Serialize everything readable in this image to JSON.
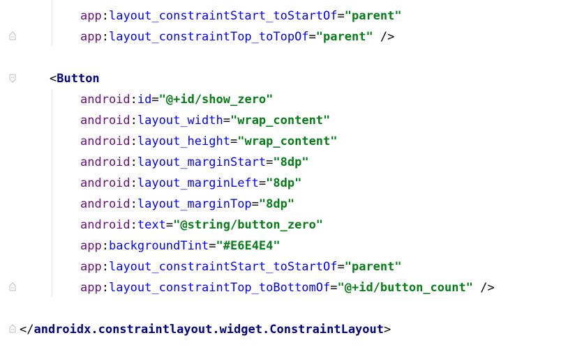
{
  "lines": [
    {
      "ns": "app",
      "sep": ":",
      "attr": "layout_constraintStart_toStartOf",
      "eq": "=",
      "value": "\"parent\"",
      "tail": ""
    },
    {
      "ns": "app",
      "sep": ":",
      "attr": "layout_constraintTop_toTopOf",
      "eq": "=",
      "value": "\"parent\"",
      "tail": " />"
    },
    {
      "open_bracket": "<",
      "tag": "Button"
    },
    {
      "ns": "android",
      "sep": ":",
      "attr": "id",
      "eq": "=",
      "value": "\"@+id/show_zero\""
    },
    {
      "ns": "android",
      "sep": ":",
      "attr": "layout_width",
      "eq": "=",
      "value": "\"wrap_content\""
    },
    {
      "ns": "android",
      "sep": ":",
      "attr": "layout_height",
      "eq": "=",
      "value": "\"wrap_content\""
    },
    {
      "ns": "android",
      "sep": ":",
      "attr": "layout_marginStart",
      "eq": "=",
      "value": "\"8dp\""
    },
    {
      "ns": "android",
      "sep": ":",
      "attr": "layout_marginLeft",
      "eq": "=",
      "value": "\"8dp\""
    },
    {
      "ns": "android",
      "sep": ":",
      "attr": "layout_marginTop",
      "eq": "=",
      "value": "\"8dp\""
    },
    {
      "ns": "android",
      "sep": ":",
      "attr": "text",
      "eq": "=",
      "value": "\"@string/button_zero\""
    },
    {
      "ns": "app",
      "sep": ":",
      "attr": "backgroundTint",
      "eq": "=",
      "value": "\"#E6E4E4\""
    },
    {
      "ns": "app",
      "sep": ":",
      "attr": "layout_constraintStart_toStartOf",
      "eq": "=",
      "value": "\"parent\""
    },
    {
      "ns": "app",
      "sep": ":",
      "attr": "layout_constraintTop_toBottomOf",
      "eq": "=",
      "value": "\"@+id/button_count\"",
      "tail": " />"
    },
    {
      "close_bracket": "</",
      "tag": "androidx.constraintlayout.widget.ConstraintLayout",
      "end": ">"
    }
  ],
  "colors": {
    "namespace_android": "#660e7a",
    "namespace_app": "#660e7a",
    "attribute": "#0000ff",
    "value": "#067d17",
    "tag": "#000080",
    "background": "#ffffff"
  }
}
